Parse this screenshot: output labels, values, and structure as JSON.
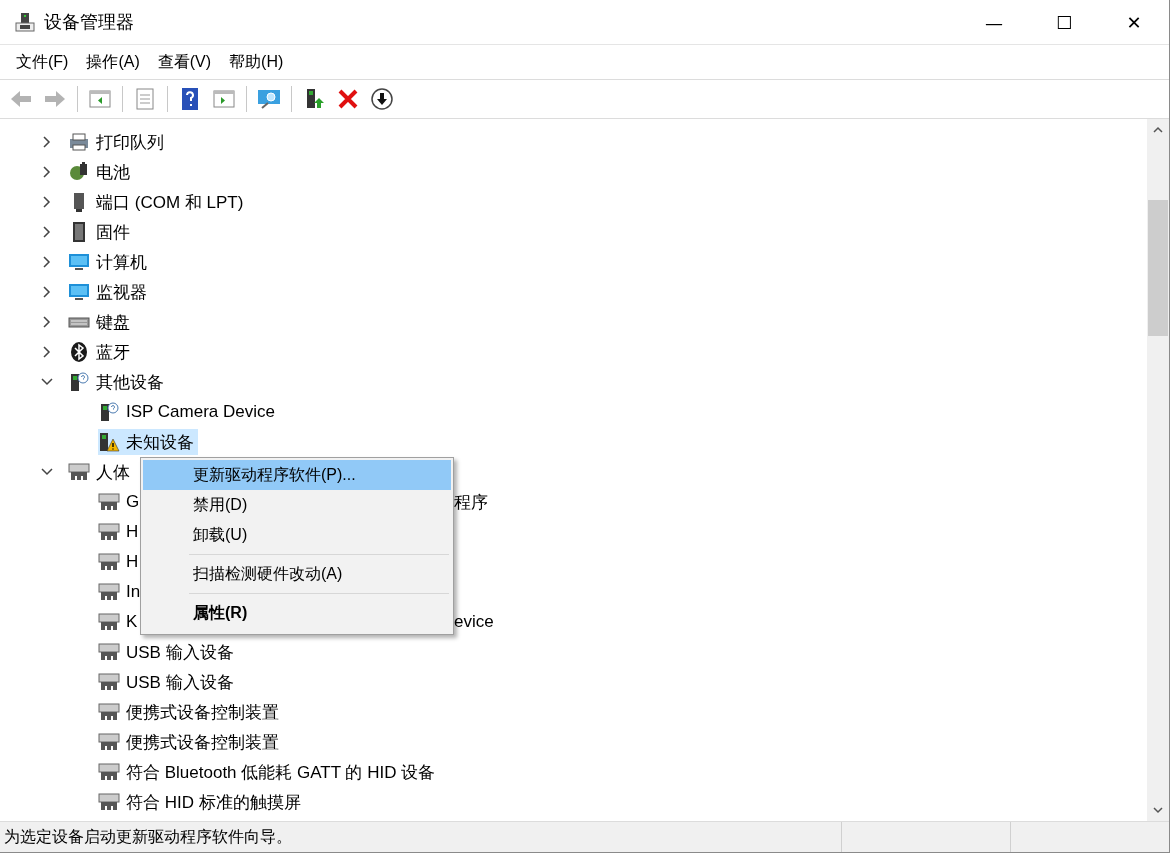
{
  "window": {
    "title": "设备管理器",
    "controls": [
      "—",
      "☐",
      "✕"
    ]
  },
  "menu_bar": [
    {
      "label": "文件(F)"
    },
    {
      "label": "操作(A)"
    },
    {
      "label": "查看(V)"
    },
    {
      "label": "帮助(H)"
    }
  ],
  "toolbar": [
    {
      "kind": "back",
      "disabled": true
    },
    {
      "kind": "forward",
      "disabled": true
    },
    {
      "kind": "sep"
    },
    {
      "kind": "tree",
      "disabled": false
    },
    {
      "kind": "sep"
    },
    {
      "kind": "props",
      "disabled": false
    },
    {
      "kind": "sep"
    },
    {
      "kind": "help",
      "disabled": false
    },
    {
      "kind": "pane",
      "disabled": false
    },
    {
      "kind": "sep"
    },
    {
      "kind": "scan",
      "disabled": false
    },
    {
      "kind": "sep"
    },
    {
      "kind": "update",
      "disabled": false
    },
    {
      "kind": "remove",
      "disabled": false
    },
    {
      "kind": "download",
      "disabled": false
    }
  ],
  "tree": [
    {
      "label": "打印队列",
      "kind": "printer",
      "expanded": false,
      "selected": false
    },
    {
      "label": "电池",
      "kind": "battery",
      "expanded": false,
      "selected": false
    },
    {
      "label": "端口 (COM 和 LPT)",
      "kind": "port",
      "expanded": false,
      "selected": false
    },
    {
      "label": "固件",
      "kind": "chip",
      "expanded": false,
      "selected": false
    },
    {
      "label": "计算机",
      "kind": "monitor",
      "expanded": false,
      "selected": false
    },
    {
      "label": "监视器",
      "kind": "monitor",
      "expanded": false,
      "selected": false
    },
    {
      "label": "键盘",
      "kind": "keyboard",
      "expanded": false,
      "selected": false
    },
    {
      "label": "蓝牙",
      "kind": "bluetooth",
      "expanded": false,
      "selected": false
    },
    {
      "label": "其他设备",
      "kind": "unknown",
      "expanded": true,
      "selected": false,
      "children": [
        {
          "label": "ISP Camera Device",
          "kind": "unknown",
          "selected": false
        },
        {
          "label": "未知设备",
          "kind": "warning",
          "selected": true
        }
      ]
    },
    {
      "label": "人体",
      "kind": "hid",
      "expanded": true,
      "selected": false,
      "children": [
        {
          "label": "G",
          "tail": "程序",
          "kind": "hid",
          "selected": false
        },
        {
          "label": "H",
          "kind": "hid",
          "selected": false
        },
        {
          "label": "H",
          "kind": "hid",
          "selected": false
        },
        {
          "label": "In",
          "kind": "hid",
          "selected": false
        },
        {
          "label": "K",
          "tail": "evice",
          "kind": "hid",
          "selected": false
        },
        {
          "label": "USB 输入设备",
          "kind": "hid",
          "selected": false
        },
        {
          "label": "USB 输入设备",
          "kind": "hid",
          "selected": false
        },
        {
          "label": "便携式设备控制装置",
          "kind": "hid",
          "selected": false
        },
        {
          "label": "便携式设备控制装置",
          "kind": "hid",
          "selected": false
        },
        {
          "label": "符合 Bluetooth 低能耗 GATT 的 HID 设备",
          "kind": "hid",
          "selected": false
        },
        {
          "label": "符合 HID 标准的触摸屏",
          "kind": "hid",
          "selected": false
        }
      ]
    }
  ],
  "context_menu": [
    {
      "kind": "item",
      "label": "更新驱动程序软件(P)...",
      "selected": true,
      "default": false
    },
    {
      "kind": "item",
      "label": "禁用(D)",
      "selected": false,
      "default": false
    },
    {
      "kind": "item",
      "label": "卸载(U)",
      "selected": false,
      "default": false
    },
    {
      "kind": "separator"
    },
    {
      "kind": "item",
      "label": "扫描检测硬件改动(A)",
      "selected": false,
      "default": false
    },
    {
      "kind": "separator"
    },
    {
      "kind": "item",
      "label": "属性(R)",
      "selected": false,
      "default": true
    }
  ],
  "status_bar": {
    "text": "为选定设备启动更新驱动程序软件向导。"
  }
}
